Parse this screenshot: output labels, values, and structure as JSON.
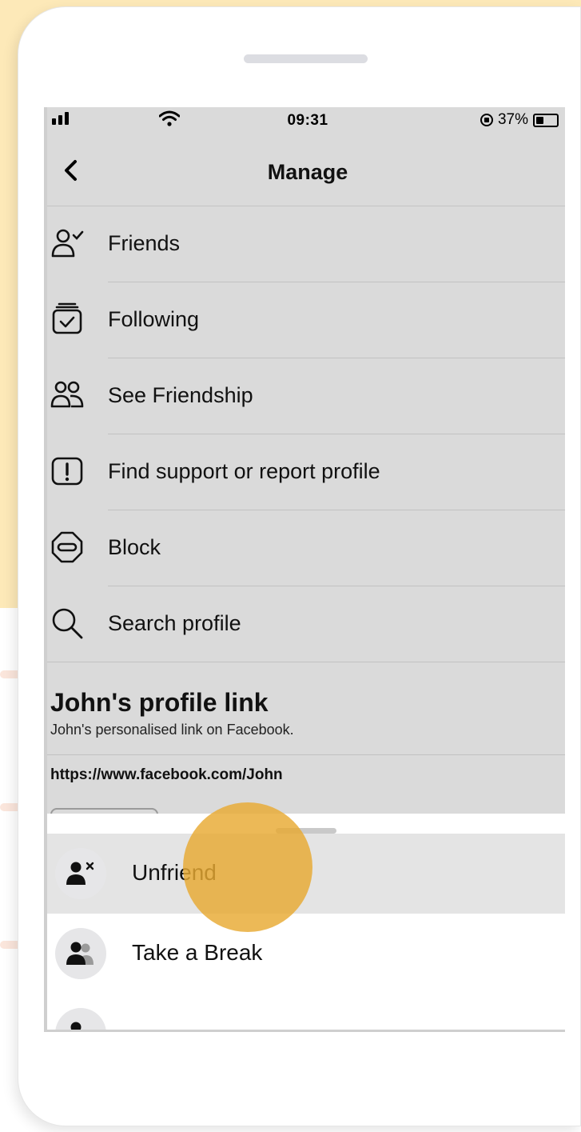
{
  "status_bar": {
    "time": "09:31",
    "battery": "37%",
    "battery_level": 0.37
  },
  "header": {
    "title": "Manage"
  },
  "menu": [
    {
      "label": "Friends",
      "icon": "friend-check-icon"
    },
    {
      "label": "Following",
      "icon": "following-icon"
    },
    {
      "label": "See Friendship",
      "icon": "friendship-icon"
    },
    {
      "label": "Find support or report profile",
      "icon": "report-icon"
    },
    {
      "label": "Block",
      "icon": "block-icon"
    },
    {
      "label": "Search profile",
      "icon": "search-icon"
    }
  ],
  "profile_link": {
    "title": "John's profile link",
    "subtitle": "John's personalised link on Facebook.",
    "url": "https://www.facebook.com/John"
  },
  "sheet": {
    "items": [
      {
        "label": "Unfriend",
        "icon": "unfriend-icon"
      },
      {
        "label": "Take a Break",
        "icon": "take-a-break-icon"
      }
    ]
  },
  "colors": {
    "tap_highlight": "#e8aa32",
    "background_accent": "#fde9b8"
  }
}
